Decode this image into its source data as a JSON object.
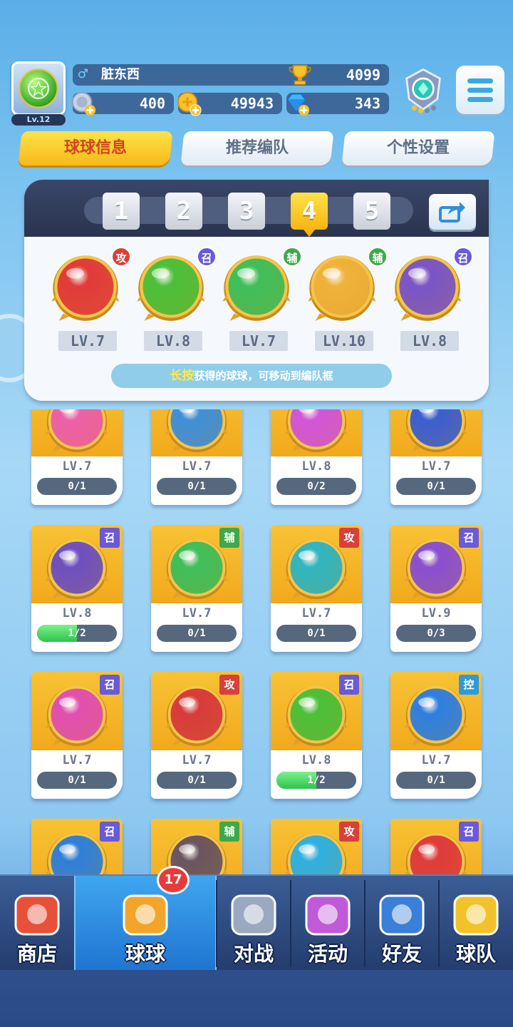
{
  "player": {
    "name": "脏东西",
    "gender_symbol": "♂",
    "level": "Lv.12",
    "trophies": "4099",
    "silver": "400",
    "gold": "49943",
    "diamonds": "343"
  },
  "icons": {
    "menu": "hamburger-menu-icon",
    "share": "share-arrow-icon",
    "trophy": "trophy-icon",
    "rank": "rank-emblem-icon"
  },
  "tabs": [
    {
      "label": "球球信息",
      "active": true
    },
    {
      "label": "推荐编队",
      "active": false
    },
    {
      "label": "个性设置",
      "active": false
    }
  ],
  "formation": {
    "slots": [
      "1",
      "2",
      "3",
      "4",
      "5"
    ],
    "active_slot": "4",
    "balls": [
      {
        "type": "攻",
        "level": "LV.7",
        "color": "#e23b3b"
      },
      {
        "type": "召",
        "level": "LV.8",
        "color": "#4cc03a"
      },
      {
        "type": "辅",
        "level": "LV.7",
        "color": "#3fbf5a"
      },
      {
        "type": "辅",
        "level": "LV.10",
        "color": "#f0b23a"
      },
      {
        "type": "召",
        "level": "LV.8",
        "color": "#7a55c8"
      }
    ],
    "hint_highlight": "长按",
    "hint_text": "获得的球球，可移动到编队框"
  },
  "collection": [
    {
      "type": "",
      "level": "LV.7",
      "progress": "0/1",
      "fraction": 0,
      "color": "#ef5fa8"
    },
    {
      "type": "",
      "level": "LV.7",
      "progress": "0/1",
      "fraction": 0,
      "color": "#3f8fd8"
    },
    {
      "type": "",
      "level": "LV.8",
      "progress": "0/2",
      "fraction": 0,
      "color": "#d355d8"
    },
    {
      "type": "",
      "level": "LV.7",
      "progress": "0/1",
      "fraction": 0,
      "color": "#3b5ed0"
    },
    {
      "type": "召",
      "level": "LV.8",
      "progress": "1/2",
      "fraction": 0.5,
      "color": "#6e50c0"
    },
    {
      "type": "辅",
      "level": "LV.7",
      "progress": "0/1",
      "fraction": 0,
      "color": "#3fbf5a"
    },
    {
      "type": "攻",
      "level": "LV.7",
      "progress": "0/1",
      "fraction": 0,
      "color": "#2fb6c0"
    },
    {
      "type": "召",
      "level": "LV.9",
      "progress": "0/3",
      "fraction": 0,
      "color": "#8a4fd0"
    },
    {
      "type": "召",
      "level": "LV.7",
      "progress": "0/1",
      "fraction": 0,
      "color": "#e24fb0"
    },
    {
      "type": "攻",
      "level": "LV.7",
      "progress": "0/1",
      "fraction": 0,
      "color": "#d83b3b"
    },
    {
      "type": "召",
      "level": "LV.8",
      "progress": "1/2",
      "fraction": 0.5,
      "color": "#4cc03a"
    },
    {
      "type": "控",
      "level": "LV.7",
      "progress": "0/1",
      "fraction": 0,
      "color": "#2e7fe0"
    },
    {
      "type": "召",
      "level": "",
      "progress": "",
      "fraction": 0,
      "color": "#2f7fd8"
    },
    {
      "type": "辅",
      "level": "",
      "progress": "",
      "fraction": 0,
      "color": "#6a5560"
    },
    {
      "type": "攻",
      "level": "",
      "progress": "",
      "fraction": 0,
      "color": "#2fb0e0"
    },
    {
      "type": "召",
      "level": "",
      "progress": "",
      "fraction": 0,
      "color": "#e03b3b"
    }
  ],
  "type_colors": {
    "攻": "#d8403a",
    "召": "#6a5ad8",
    "辅": "#3fa84a",
    "控": "#2f9ad8"
  },
  "nav": {
    "badge": "17",
    "items": [
      {
        "label": "商店",
        "icon": "shop-icon"
      },
      {
        "label": "球球",
        "icon": "ball-cannon-icon"
      },
      {
        "label": "对战",
        "icon": "crossed-swords-icon"
      },
      {
        "label": "活动",
        "icon": "party-popper-icon"
      },
      {
        "label": "好友",
        "icon": "friends-book-icon"
      },
      {
        "label": "球队",
        "icon": "whistle-icon"
      }
    ]
  }
}
